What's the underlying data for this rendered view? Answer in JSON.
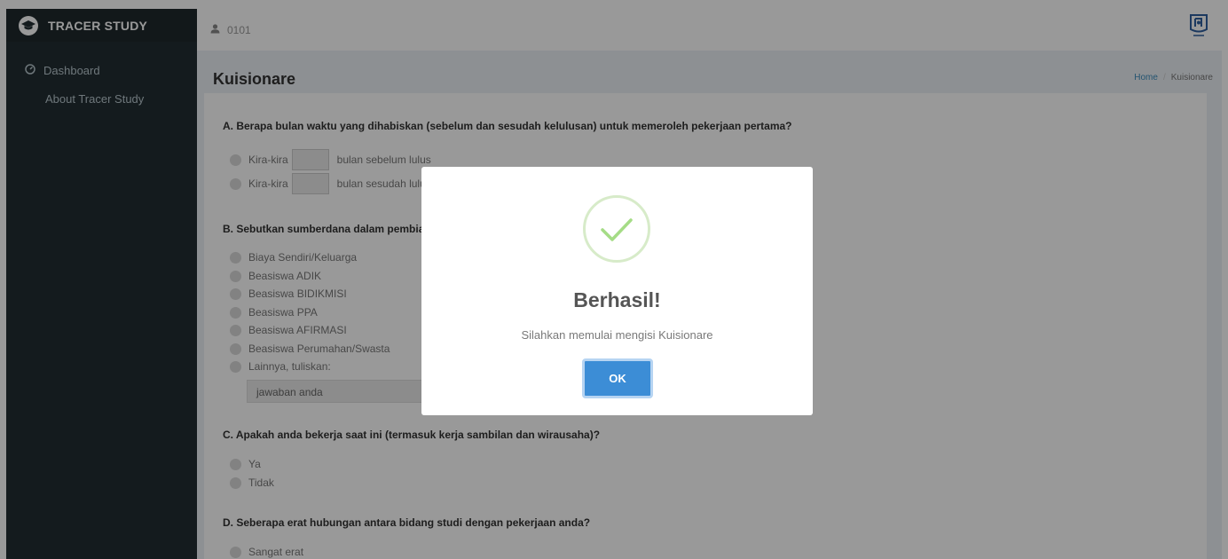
{
  "brand": {
    "title": "TRACER STUDY"
  },
  "sidebar": {
    "items": [
      {
        "label": "Dashboard"
      },
      {
        "label": "About Tracer Study"
      }
    ]
  },
  "topbar": {
    "user": "0101"
  },
  "header": {
    "title": "Kuisionare",
    "breadcrumb": {
      "home": "Home",
      "current": "Kuisionare"
    }
  },
  "questionnaire": {
    "q_a": {
      "text": "A. Berapa bulan waktu yang dihabiskan (sebelum dan sesudah kelulusan) untuk memeroleh pekerjaan pertama?",
      "opt1_prefix": "Kira-kira",
      "opt1_suffix": "bulan sebelum lulus",
      "opt2_prefix": "Kira-kira",
      "opt2_suffix": "bulan sesudah lulus"
    },
    "q_b": {
      "text": "B. Sebutkan sumberdana dalam pembiayaan kuliah?",
      "options": [
        "Biaya Sendiri/Keluarga",
        "Beasiswa ADIK",
        "Beasiswa BIDIKMISI",
        "Beasiswa PPA",
        "Beasiswa AFIRMASI",
        "Beasiswa Perumahan/Swasta",
        "Lainnya, tuliskan:"
      ],
      "answer_placeholder": "jawaban anda"
    },
    "q_c": {
      "text": "C. Apakah anda bekerja saat ini (termasuk kerja sambilan dan wirausaha)?",
      "options": [
        "Ya",
        "Tidak"
      ]
    },
    "q_d": {
      "text": "D. Seberapa erat hubungan antara bidang studi dengan pekerjaan anda?",
      "options": [
        "Sangat erat"
      ]
    }
  },
  "modal": {
    "title": "Berhasil!",
    "message": "Silahkan memulai mengisi Kuisionare",
    "ok_label": "OK"
  },
  "colors": {
    "sidebar": "#222d32",
    "brand_bar": "#1e282c",
    "accent": "#3c8dbc",
    "ok_button": "#3c8dd6",
    "success": "#a5dc86"
  },
  "icons": {
    "brand": "graduation-cap-icon",
    "dashboard": "dashboard-icon",
    "user": "user-icon",
    "logo": "university-logo-icon",
    "success": "check-icon"
  }
}
